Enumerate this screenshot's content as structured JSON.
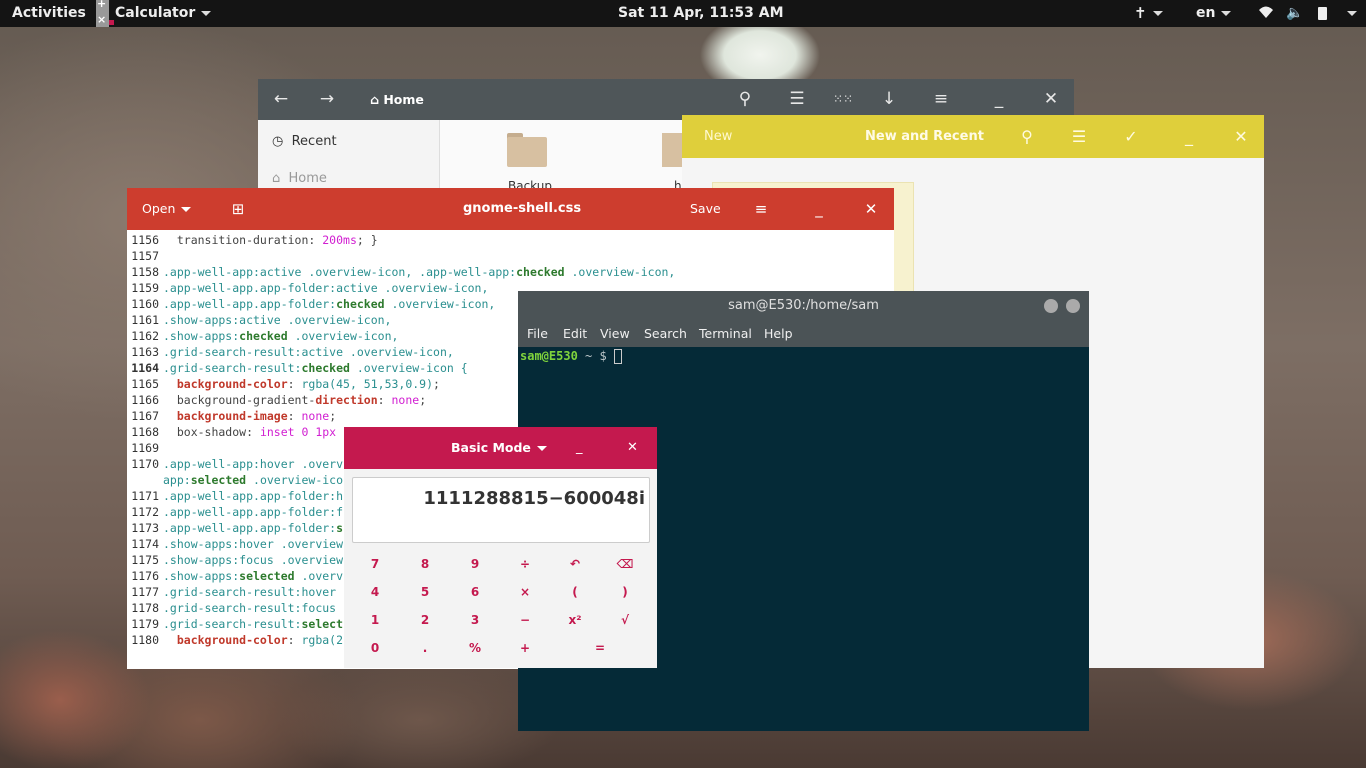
{
  "topbar": {
    "activities": "Activities",
    "app": "Calculator",
    "clock": "Sat 11 Apr, 11:53 AM",
    "lang": "en"
  },
  "files": {
    "location": "Home",
    "sidebar": [
      {
        "label": "Recent"
      },
      {
        "label": "Home"
      }
    ],
    "folders": [
      {
        "label": "Backup"
      },
      {
        "label": "h"
      }
    ]
  },
  "notes": {
    "new": "New",
    "title": "New and Recent"
  },
  "gedit": {
    "open": "Open",
    "title": "gnome-shell.css",
    "save": "Save"
  },
  "code": [
    {
      "n": "1156",
      "t": [
        {
          "c": "pl",
          "s": "  transition-duration: "
        },
        {
          "c": "pk",
          "s": "200ms"
        },
        {
          "c": "pl",
          "s": "; }"
        }
      ]
    },
    {
      "n": "1157",
      "t": []
    },
    {
      "n": "1158",
      "t": [
        {
          "c": "",
          "s": ".app-well-app:active .overview-icon, .app-well-app:"
        },
        {
          "c": "kw",
          "s": "checked"
        },
        {
          "c": "",
          "s": " .overview-icon,"
        }
      ]
    },
    {
      "n": "1159",
      "t": [
        {
          "c": "",
          "s": ".app-well-app.app-folder:active .overview-icon,"
        }
      ]
    },
    {
      "n": "1160",
      "t": [
        {
          "c": "",
          "s": ".app-well-app.app-folder:"
        },
        {
          "c": "kw",
          "s": "checked"
        },
        {
          "c": "",
          "s": " .overview-icon,"
        }
      ]
    },
    {
      "n": "1161",
      "t": [
        {
          "c": "",
          "s": ".show-apps:active .overview-icon,"
        }
      ]
    },
    {
      "n": "1162",
      "t": [
        {
          "c": "",
          "s": ".show-apps:"
        },
        {
          "c": "kw",
          "s": "checked"
        },
        {
          "c": "",
          "s": " .overview-icon,"
        }
      ]
    },
    {
      "n": "1163",
      "t": [
        {
          "c": "",
          "s": ".grid-search-result:active .overview-icon,"
        }
      ]
    },
    {
      "n": "1164",
      "b": true,
      "t": [
        {
          "c": "",
          "s": ".grid-search-result:"
        },
        {
          "c": "kw",
          "s": "checked"
        },
        {
          "c": "",
          "s": " .overview-icon {"
        }
      ]
    },
    {
      "n": "1165",
      "t": [
        {
          "c": "bk",
          "s": "  background-color"
        },
        {
          "c": "pl",
          "s": ": "
        },
        {
          "c": "",
          "s": "rgba(45, 51,53,0.9)"
        },
        {
          "c": "pl",
          "s": ";"
        }
      ]
    },
    {
      "n": "1166",
      "t": [
        {
          "c": "pl",
          "s": "  background-gradient-"
        },
        {
          "c": "bk",
          "s": "direction"
        },
        {
          "c": "pl",
          "s": ": "
        },
        {
          "c": "pk",
          "s": "none"
        },
        {
          "c": "pl",
          "s": ";"
        }
      ]
    },
    {
      "n": "1167",
      "t": [
        {
          "c": "bk",
          "s": "  background-image"
        },
        {
          "c": "pl",
          "s": ": "
        },
        {
          "c": "pk",
          "s": "none"
        },
        {
          "c": "pl",
          "s": ";"
        }
      ]
    },
    {
      "n": "1168",
      "t": [
        {
          "c": "pl",
          "s": "  box-shadow: "
        },
        {
          "c": "pk",
          "s": "inset 0 1px"
        }
      ]
    },
    {
      "n": "1169",
      "t": []
    },
    {
      "n": "1170",
      "t": [
        {
          "c": "",
          "s": ".app-well-app:hover .overv"
        }
      ]
    },
    {
      "n": "",
      "t": [
        {
          "c": "",
          "s": "app:"
        },
        {
          "c": "kw",
          "s": "selected"
        },
        {
          "c": "",
          "s": " .overview-ico"
        }
      ]
    },
    {
      "n": "1171",
      "t": [
        {
          "c": "",
          "s": ".app-well-app.app-folder:h"
        }
      ]
    },
    {
      "n": "1172",
      "t": [
        {
          "c": "",
          "s": ".app-well-app.app-folder:f"
        }
      ]
    },
    {
      "n": "1173",
      "t": [
        {
          "c": "",
          "s": ".app-well-app.app-folder:"
        },
        {
          "c": "kw",
          "s": "s"
        }
      ]
    },
    {
      "n": "1174",
      "t": [
        {
          "c": "",
          "s": ".show-apps:hover .overview"
        }
      ]
    },
    {
      "n": "1175",
      "t": [
        {
          "c": "",
          "s": ".show-apps:focus .overview"
        }
      ]
    },
    {
      "n": "1176",
      "t": [
        {
          "c": "",
          "s": ".show-apps:"
        },
        {
          "c": "kw",
          "s": "selected"
        },
        {
          "c": "",
          "s": " .overv"
        }
      ]
    },
    {
      "n": "1177",
      "t": [
        {
          "c": "",
          "s": ".grid-search-result:hover"
        }
      ]
    },
    {
      "n": "1178",
      "t": [
        {
          "c": "",
          "s": ".grid-search-result:focus"
        }
      ]
    },
    {
      "n": "1179",
      "t": [
        {
          "c": "",
          "s": ".grid-search-result:"
        },
        {
          "c": "kw",
          "s": "select"
        }
      ]
    },
    {
      "n": "1180",
      "t": [
        {
          "c": "bk",
          "s": "  background-color"
        },
        {
          "c": "pl",
          "s": ": "
        },
        {
          "c": "",
          "s": "rgba(2"
        }
      ]
    }
  ],
  "terminal": {
    "title": "sam@E530:/home/sam",
    "menu": [
      "File",
      "Edit",
      "View",
      "Search",
      "Terminal",
      "Help"
    ],
    "prompt_user": "sam@E530",
    "prompt_rest": " ~ $ "
  },
  "calc": {
    "mode": "Basic Mode",
    "display": "1111288815−600048i",
    "keys": [
      [
        "7",
        "8",
        "9",
        "÷",
        "↶",
        "⌫"
      ],
      [
        "4",
        "5",
        "6",
        "×",
        "(",
        ")"
      ],
      [
        "1",
        "2",
        "3",
        "−",
        "x²",
        "√"
      ],
      [
        "0",
        ".",
        "%",
        "+",
        "",
        "="
      ]
    ]
  },
  "colors": {
    "gedit": "#cd3d2e",
    "notes": "#dfcf3b",
    "calc": "#c4194e",
    "terminal": "#052a37"
  }
}
